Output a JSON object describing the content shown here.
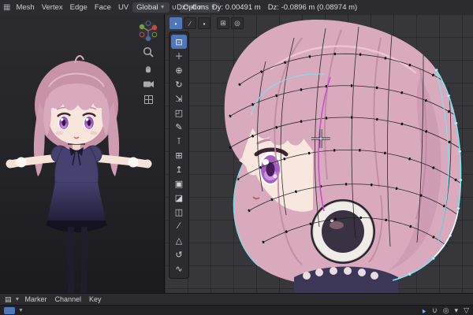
{
  "colors": {
    "accent": "#4f76b8",
    "selection_cyan": "#74e8f2",
    "seam_magenta": "#c653cc",
    "hair_pink": "#d9a9bd"
  },
  "menubar": {
    "menus": [
      "Mesh",
      "Vertex",
      "Edge",
      "Face",
      "UV"
    ],
    "orientation_label": "Global",
    "options_label": "Options",
    "readout": {
      "dx": "Dx: -0 m",
      "dy": "Dy: 0.00491 m",
      "dz": "Dz: -0.0896 m (0.08974 m)"
    }
  },
  "edit_header": {
    "select_modes": [
      {
        "name": "vertex-select",
        "glyph": "•"
      },
      {
        "name": "edge-select",
        "glyph": "∕"
      },
      {
        "name": "face-select",
        "glyph": "▪"
      }
    ],
    "extra": [
      {
        "name": "global-orientation",
        "glyph": "⊞"
      },
      {
        "name": "snap",
        "glyph": "◎"
      }
    ]
  },
  "toolbar": {
    "active_tool": "select-box",
    "tools": [
      {
        "name": "select-box",
        "glyph": "⊡"
      },
      {
        "name": "cursor",
        "glyph": "＋"
      },
      {
        "name": "move",
        "glyph": "⊕"
      },
      {
        "name": "rotate",
        "glyph": "↻"
      },
      {
        "name": "scale",
        "glyph": "⇲"
      },
      {
        "name": "transform",
        "glyph": "◰"
      },
      {
        "name": "annotate",
        "glyph": "✎"
      },
      {
        "name": "measure",
        "glyph": "⊺"
      },
      {
        "name": "add-primitive",
        "glyph": "⊞"
      },
      {
        "name": "extrude-region",
        "glyph": "↥"
      },
      {
        "name": "inset-faces",
        "glyph": "▣"
      },
      {
        "name": "bevel",
        "glyph": "◪"
      },
      {
        "name": "loop-cut",
        "glyph": "◫"
      },
      {
        "name": "knife",
        "glyph": "∕"
      },
      {
        "name": "poly-build",
        "glyph": "△"
      },
      {
        "name": "spin",
        "glyph": "↺"
      },
      {
        "name": "smooth",
        "glyph": "∿"
      }
    ]
  },
  "timeline": {
    "menus": [
      "Marker",
      "Channel",
      "Key"
    ]
  },
  "statusbar": {
    "icons": [
      {
        "name": "select-cursor-icon",
        "glyph": "▲"
      },
      {
        "name": "snap-magnet-icon",
        "glyph": "∪"
      },
      {
        "name": "proportional-icon",
        "glyph": "◎"
      },
      {
        "name": "dropdown-chevron-icon",
        "glyph": "▾"
      },
      {
        "name": "filter-funnel-icon",
        "glyph": "▽"
      }
    ]
  }
}
